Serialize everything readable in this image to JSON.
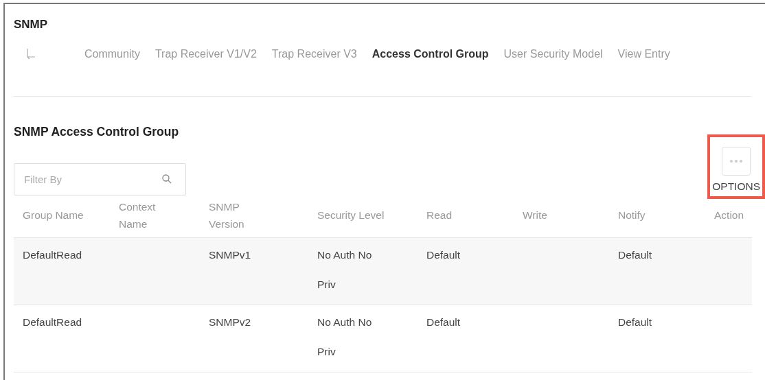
{
  "page": {
    "title": "SNMP"
  },
  "tabs": [
    {
      "label": "Community",
      "selected": false
    },
    {
      "label": "Trap Receiver V1/V2",
      "selected": false
    },
    {
      "label": "Trap Receiver V3",
      "selected": false
    },
    {
      "label": "Access Control Group",
      "selected": true
    },
    {
      "label": "User Security Model",
      "selected": false
    },
    {
      "label": "View Entry",
      "selected": false
    }
  ],
  "section": {
    "title": "SNMP Access Control Group"
  },
  "filter": {
    "placeholder": "Filter By"
  },
  "options": {
    "label": "OPTIONS",
    "highlighted": true
  },
  "table": {
    "columns": [
      "Group Name",
      "Context Name",
      "SNMP Version",
      "Security Level",
      "Read",
      "Write",
      "Notify",
      "Action"
    ],
    "rows": [
      {
        "cells": [
          "DefaultRead",
          "",
          "SNMPv1",
          "No Auth No Priv",
          "Default",
          "",
          "Default",
          ""
        ]
      },
      {
        "cells": [
          "DefaultRead",
          "",
          "SNMPv2",
          "No Auth No Priv",
          "Default",
          "",
          "Default",
          ""
        ]
      }
    ]
  }
}
